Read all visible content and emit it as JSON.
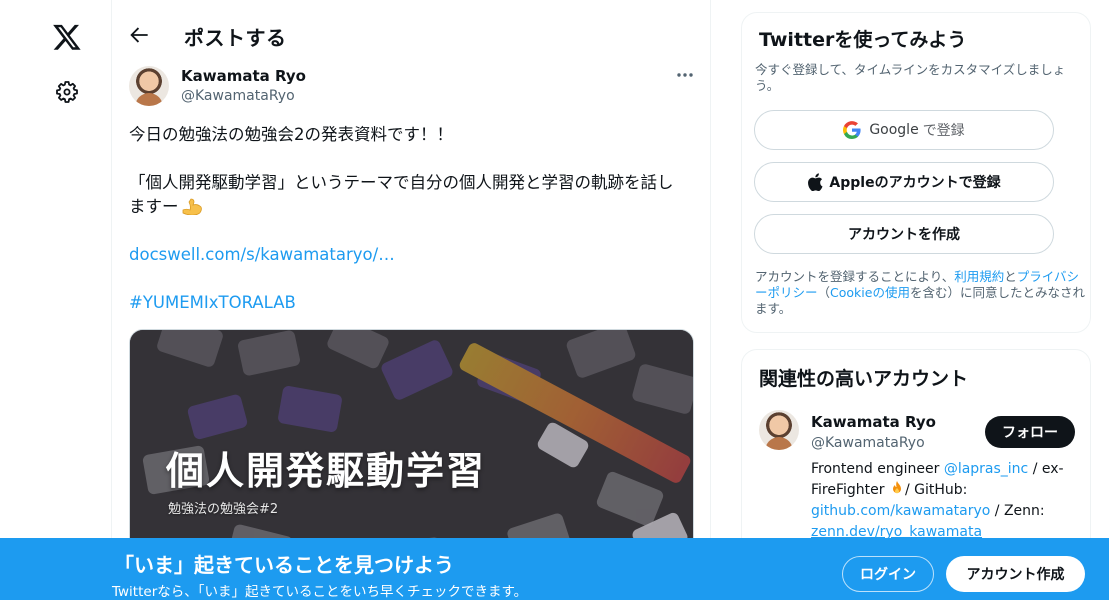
{
  "nav": {
    "x_logo_icon": "x-logo-icon",
    "settings_icon": "gear-icon"
  },
  "header": {
    "title": "ポストする",
    "back_icon": "arrow-left-icon"
  },
  "tweet": {
    "author_name": "Kawamata Ryo",
    "author_handle": "@KawamataRyo",
    "text_line1": "今日の勉強法の勉強会2の発表資料です！！",
    "text_line2": "「個人開発駆動学習」というテーマで自分の個人開発と学習の軌跡を話し",
    "text_line3": "ますー",
    "emoji": "flexed-biceps",
    "link": "docswell.com/s/kawamataryo/…",
    "hashtag": "#YUMEMIxTORALAB",
    "media": {
      "title": "個人開発駆動学習",
      "subtitle": "勉強法の勉強会#2"
    }
  },
  "signup": {
    "title": "Twitterを使ってみよう",
    "subtitle": "今すぐ登録して、タイムラインをカスタマイズしましょう。",
    "google_label": "Google",
    "google_suffix": "で登録",
    "apple_label": "Appleのアカウントで登録",
    "create_label": "アカウントを作成",
    "legal_prefix": "アカウントを登録することにより、",
    "legal_terms": "利用規約",
    "legal_and": "と",
    "legal_privacy": "プライバシーポリシー",
    "legal_paren_open": "（",
    "legal_cookie": "Cookieの使用",
    "legal_suffix": "を含む）に同意したとみなされます。"
  },
  "related": {
    "title": "関連性の高いアカウント",
    "name": "Kawamata Ryo",
    "handle": "@KawamataRyo",
    "follow_label": "フォロー",
    "bio_part1": "Frontend engineer ",
    "bio_mention": "@lapras_inc",
    "bio_part2": " / ex-FireFighter ",
    "bio_part3": "/ GitHub: ",
    "bio_github": "github.com/kawamataryo",
    "bio_part4": " / Zenn: ",
    "bio_zenn": "zenn.dev/ryo_kawamata"
  },
  "banner": {
    "title": "「いま」起きていることを見つけよう",
    "subtitle": "Twitterなら、「いま」起きていることをいち早くチェックできます。",
    "login_label": "ログイン",
    "signup_label": "アカウント作成"
  },
  "colors": {
    "accent": "#1d9bf0",
    "text": "#0f1419",
    "muted": "#536471"
  }
}
